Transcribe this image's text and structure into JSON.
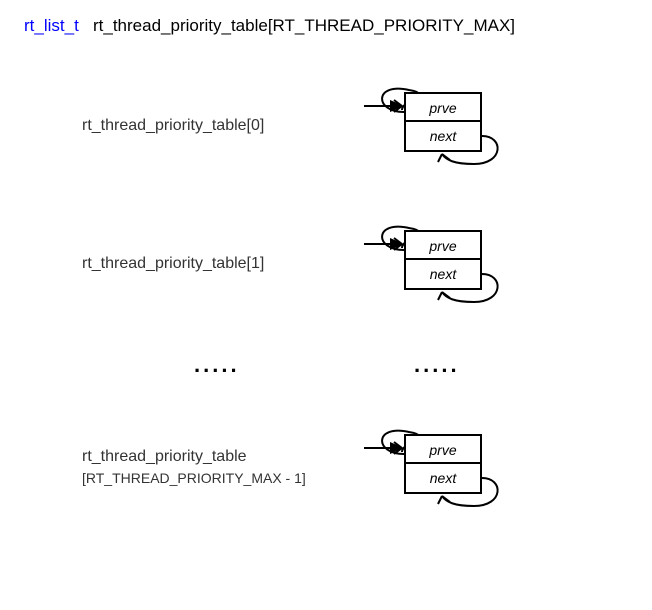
{
  "title": {
    "type": "rt_list_t",
    "declaration": "rt_thread_priority_table[RT_THREAD_PRIORITY_MAX]"
  },
  "rows": [
    {
      "label_main": "rt_thread_priority_table[0]",
      "label_sub": "",
      "prve": "prve",
      "next": "next"
    },
    {
      "label_main": "rt_thread_priority_table[1]",
      "label_sub": "",
      "prve": "prve",
      "next": "next"
    },
    {
      "label_main": "rt_thread_priority_table",
      "label_sub": "[RT_THREAD_PRIORITY_MAX - 1]",
      "prve": "prve",
      "next": "next"
    }
  ],
  "dots": ".....",
  "arrow_marker": "arrowhead"
}
